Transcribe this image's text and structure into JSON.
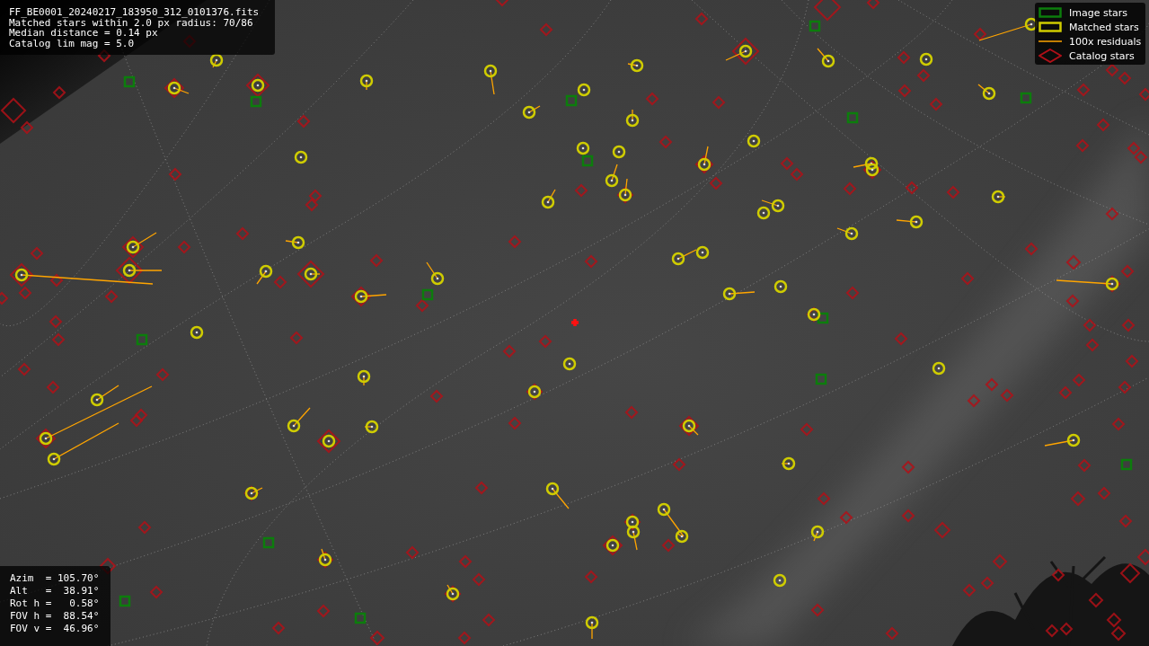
{
  "info_panel": {
    "lines": [
      "FF_BE0001_20240217_183950_312_0101376.fits",
      "Matched stars within 2.0 px radius: 70/86",
      "Median distance = 0.14 px",
      "Catalog lim mag = 5.0"
    ]
  },
  "legend": [
    {
      "kind": "image",
      "label": "Image stars"
    },
    {
      "kind": "matched",
      "label": "Matched stars"
    },
    {
      "kind": "residual",
      "label": "100x residuals"
    },
    {
      "kind": "catalog",
      "label": "Catalog stars"
    }
  ],
  "pointing_panel": {
    "lines": [
      "Azim  = 105.70°",
      "Alt   =  38.91°",
      "Rot h =   0.58°",
      "FOV h =  88.54°",
      "FOV v =  46.96°"
    ]
  }
}
